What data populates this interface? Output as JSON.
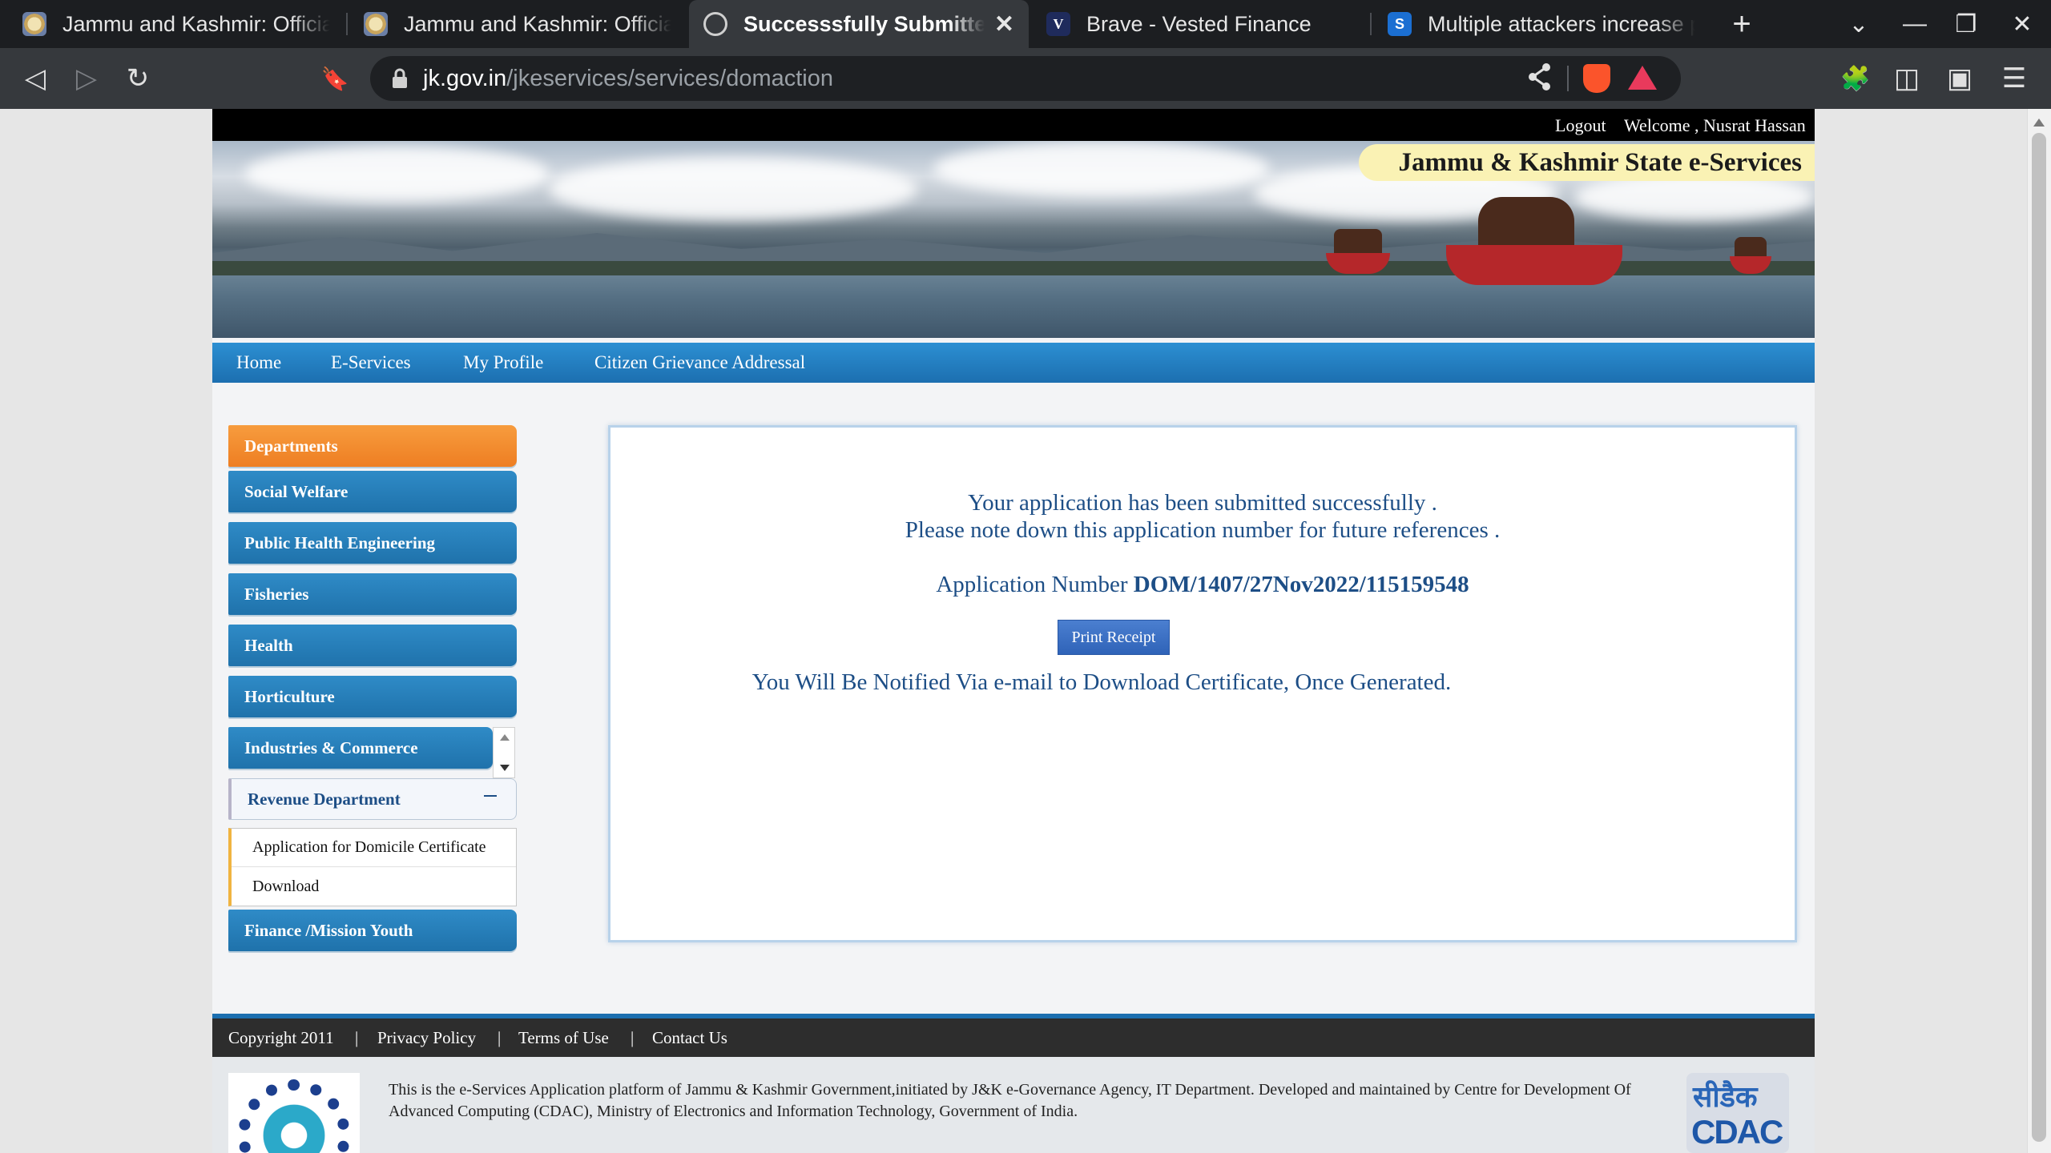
{
  "browser": {
    "tabs": [
      {
        "title": "Jammu and Kashmir: Official P",
        "favicon": "jk-emblem-icon"
      },
      {
        "title": "Jammu and Kashmir: Official P",
        "favicon": "jk-emblem-icon"
      },
      {
        "title": "Successsfully Submitted A",
        "favicon": "globe-icon",
        "active": true
      },
      {
        "title": "Brave - Vested Finance",
        "favicon": "vested-icon",
        "favicon_text": "V"
      },
      {
        "title": "Multiple attackers increase pr",
        "favicon": "s-icon",
        "favicon_text": "S"
      }
    ],
    "url": {
      "domain": "jk.gov.in",
      "path": "/jkeservices/services/domaction"
    },
    "icons": {
      "new_tab": "+",
      "tab_menu": "⌄",
      "minimize": "—",
      "restore": "❐",
      "close": "✕",
      "tab_close": "✕",
      "back": "◁",
      "forward": "▷",
      "reload": "↻",
      "bookmark": "🔖",
      "share": "⋖",
      "extensions": "🧩",
      "sidebar": "◫",
      "wallet": "▣",
      "menu": "☰"
    }
  },
  "header": {
    "logout": "Logout",
    "welcome": "Welcome , Nusrat Hassan",
    "site_title": "Jammu & Kashmir State e-Services"
  },
  "nav": [
    "Home",
    "E-Services",
    "My Profile",
    "Citizen Grievance Addressal"
  ],
  "sidebar": {
    "items": [
      "Departments",
      "Social Welfare",
      "Public Health Engineering",
      "Fisheries",
      "Health",
      "Horticulture",
      "Industries & Commerce",
      "Revenue Department",
      "Finance /Mission Youth"
    ],
    "sub_items": [
      "Application for Domicile Certificate",
      "Download"
    ]
  },
  "content": {
    "line1": "Your application has been submitted successfully .",
    "line2": "Please note down this application number for future references .",
    "app_number_label": "Application Number",
    "app_number": "DOM/1407/27Nov2022/115159548",
    "print_button": "Print Receipt",
    "notify": "You Will Be Notified Via e-mail to Download Certificate, Once Generated."
  },
  "footer": {
    "links": [
      "Copyright 2011",
      "|",
      "Privacy Policy",
      "|",
      "Terms of Use",
      "|",
      "Contact Us"
    ],
    "description": "This is the e-Services Application platform of Jammu & Kashmir Government,initiated by J&K e-Governance Agency, IT Department. Developed and maintained by Centre for Development Of Advanced Computing (CDAC), Ministry of Electronics and Information Technology, Government of India.",
    "cdac_hindi": "सीडैक",
    "cdac_english": "CDAC"
  },
  "colors": {
    "nav_blue": "#1c6fb0",
    "sidebar_orange": "#ee7e22",
    "text_blue": "#1d4e86",
    "banner_title_bg": "#faf2b4"
  }
}
